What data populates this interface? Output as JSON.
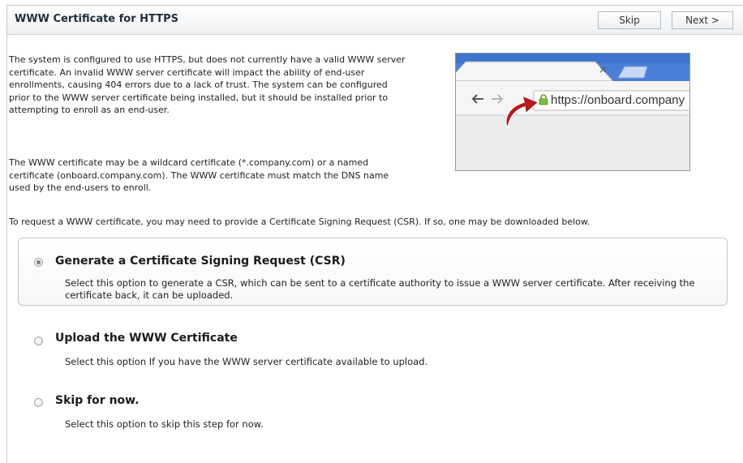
{
  "header": {
    "title": "WWW Certificate for HTTPS",
    "skip_label": "Skip",
    "next_label": "Next >"
  },
  "intro": {
    "paragraph1": "The system is configured to use HTTPS, but does not currently have a valid WWW server certificate. An invalid WWW server certificate will impact the ability of end-user enrollments, causing 404 errors due to a lack of trust. The system can be configured prior to the WWW server certificate being installed, but it should be installed prior to attempting to enroll as an end-user.",
    "paragraph2": "The WWW certificate may be a wildcard certificate (*.company.com) or a named certificate (onboard.company.com). The WWW certificate must match the DNS name used by the end-users to enroll.",
    "paragraph3": "To request a WWW certificate, you may need to provide a Certificate Signing Request (CSR). If so, one may be downloaded below."
  },
  "browser_image": {
    "tab_close": "×",
    "url": "https://onboard.company",
    "icons": [
      "lock-icon",
      "back-arrow-icon",
      "forward-arrow-icon",
      "curved-arrow-icon"
    ]
  },
  "options": [
    {
      "title": "Generate a Certificate Signing Request (CSR)",
      "description": "Select this option to generate a CSR, which can be sent to a certificate authority to issue a WWW server certificate. After receiving the certificate back, it can be uploaded.",
      "selected": true
    },
    {
      "title": "Upload the WWW Certificate",
      "description": "Select this option If you have the WWW server certificate available to upload.",
      "selected": false
    },
    {
      "title": "Skip for now.",
      "description": "Select this option to skip this step for now.",
      "selected": false
    }
  ],
  "colors": {
    "header_text": "#1f2d3d",
    "browser_chrome": "#e9e9e9",
    "lock": "#7bbf3f",
    "arrow": "#b8191b"
  }
}
